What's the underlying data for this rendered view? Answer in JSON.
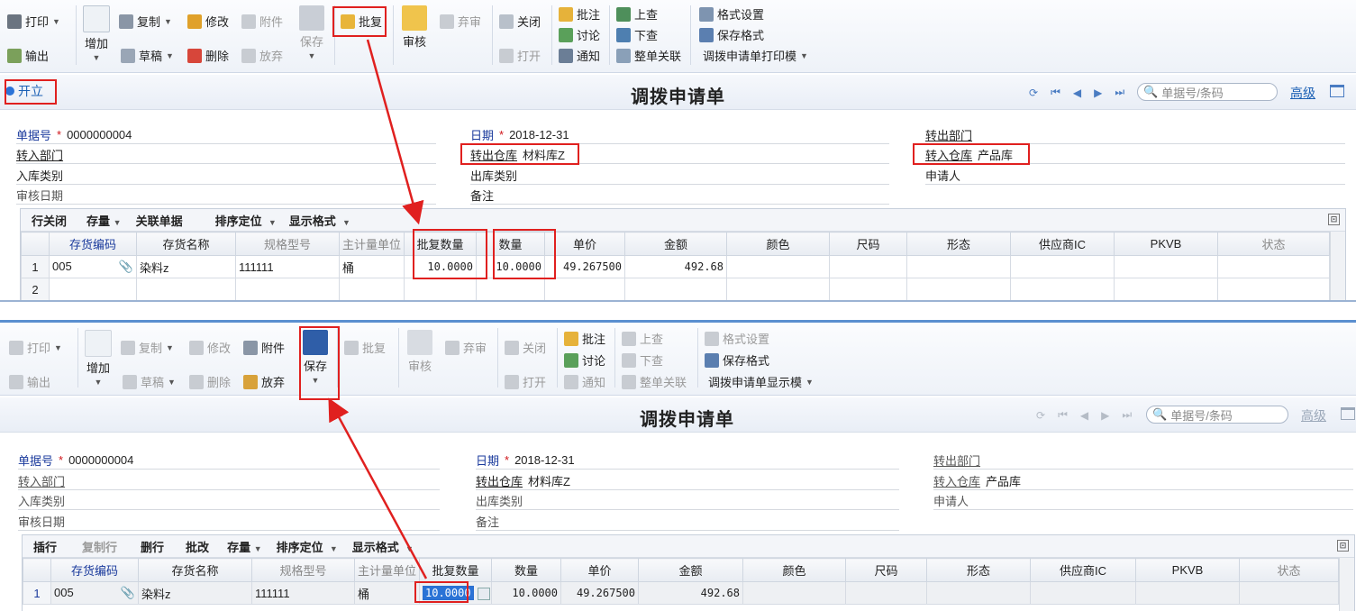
{
  "panel1": {
    "toolbar": {
      "print": "打印",
      "export": "输出",
      "add": "增加",
      "copy": "复制",
      "draft": "草稿",
      "modify": "修改",
      "delete": "删除",
      "attach": "附件",
      "discard": "放弃",
      "save": "保存",
      "batch_approve": "批复",
      "audit": "审核",
      "abandon": "弃审",
      "close": "关闭",
      "open": "打开",
      "annotate": "批注",
      "discuss": "讨论",
      "notify": "通知",
      "prev_query": "上查",
      "next_query": "下查",
      "full_link": "整单关联",
      "format_set": "格式设置",
      "save_format": "保存格式",
      "print_template": "调拨申请单打印模"
    },
    "status": "开立",
    "title": "调拨申请单",
    "search_placeholder": "单据号/条码",
    "advanced": "高级",
    "fields": {
      "doc_no_label": "单据号",
      "doc_no": "0000000004",
      "date_label": "日期",
      "date": "2018-12-31",
      "out_dept_label": "转出部门",
      "in_dept_label": "转入部门",
      "out_wh_label": "转出仓库",
      "out_wh": "材料库Z",
      "in_wh_label": "转入仓库",
      "in_wh": "产品库",
      "in_type_label": "入库类别",
      "out_type_label": "出库类别",
      "applicant_label": "申请人",
      "audit_date_label": "审核日期",
      "remark_label": "备注"
    },
    "grid_toolbar": [
      "行关闭",
      "存量",
      "关联单据",
      "排序定位",
      "显示格式"
    ],
    "columns": [
      "存货编码",
      "存货名称",
      "规格型号",
      "主计量单位",
      "批复数量",
      "数量",
      "单价",
      "金额",
      "颜色",
      "尺码",
      "形态",
      "供应商IC",
      "PKVB",
      "状态"
    ],
    "rows": [
      {
        "n": "1",
        "code": "005",
        "name": "染料z",
        "spec": "111111",
        "unit": "桶",
        "approved_qty": "10.0000",
        "qty": "10.0000",
        "price": "49.267500",
        "amount": "492.68"
      },
      {
        "n": "2"
      }
    ]
  },
  "panel2": {
    "toolbar": {
      "print": "打印",
      "export": "输出",
      "add": "增加",
      "copy": "复制",
      "draft": "草稿",
      "modify": "修改",
      "delete": "删除",
      "attach": "附件",
      "discard": "放弃",
      "save": "保存",
      "batch_approve": "批复",
      "audit": "审核",
      "abandon": "弃审",
      "close": "关闭",
      "open": "打开",
      "annotate": "批注",
      "discuss": "讨论",
      "notify": "通知",
      "prev_query": "上查",
      "next_query": "下查",
      "full_link": "整单关联",
      "format_set": "格式设置",
      "save_format": "保存格式",
      "print_template": "调拨申请单显示模"
    },
    "title": "调拨申请单",
    "search_placeholder": "单据号/条码",
    "advanced": "高级",
    "fields": {
      "doc_no_label": "单据号",
      "doc_no": "0000000004",
      "date_label": "日期",
      "date": "2018-12-31",
      "out_dept_label": "转出部门",
      "in_dept_label": "转入部门",
      "out_wh_label": "转出仓库",
      "out_wh": "材料库Z",
      "in_wh_label": "转入仓库",
      "in_wh": "产品库",
      "in_type_label": "入库类别",
      "out_type_label": "出库类别",
      "applicant_label": "申请人",
      "audit_date_label": "审核日期",
      "remark_label": "备注"
    },
    "grid_toolbar": [
      "插行",
      "复制行",
      "删行",
      "批改",
      "存量",
      "排序定位",
      "显示格式"
    ],
    "columns": [
      "存货编码",
      "存货名称",
      "规格型号",
      "主计量单位",
      "批复数量",
      "数量",
      "单价",
      "金额",
      "颜色",
      "尺码",
      "形态",
      "供应商IC",
      "PKVB",
      "状态"
    ],
    "rows": [
      {
        "n": "1",
        "code": "005",
        "name": "染料z",
        "spec": "111111",
        "unit": "桶",
        "approved_qty": "10.0000",
        "qty": "10.0000",
        "price": "49.267500",
        "amount": "492.68"
      }
    ]
  },
  "colors": {
    "accent": "#1a5fb4",
    "highlight": "#e0201f",
    "required": "#d0161b"
  }
}
